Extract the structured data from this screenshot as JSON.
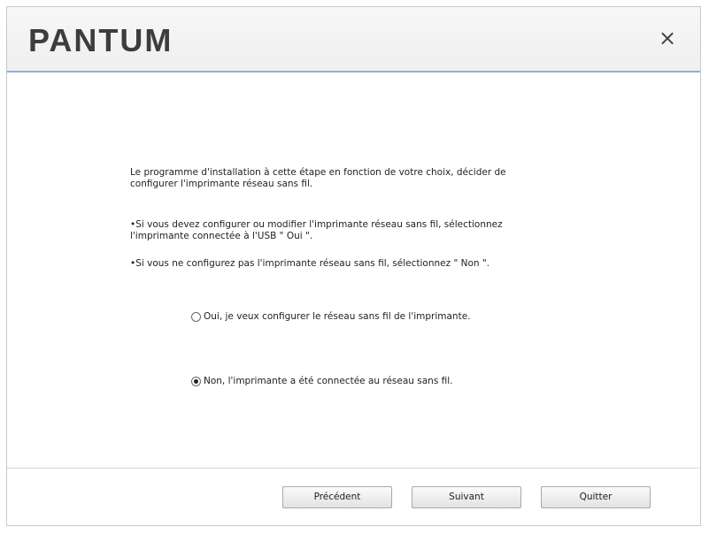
{
  "header": {
    "logo_text": "PANTUM",
    "close_glyph": "×"
  },
  "content": {
    "intro_line1": "Le programme d'installation à cette étape en fonction de votre choix, décider de",
    "intro_line2": "configurer l'imprimante réseau sans fil.",
    "bullet1_line1": "•Si vous devez configurer ou modifier l'imprimante réseau sans fil, sélectionnez",
    "bullet1_line2": "l'imprimante connectée à l'USB \" Oui \".",
    "bullet2": "•Si vous ne configurez pas l'imprimante réseau sans fil, sélectionnez \" Non \".",
    "options": [
      {
        "label": "Oui, je veux configurer le réseau sans fil de l'imprimante.",
        "selected": false
      },
      {
        "label": "Non, l'imprimante a été connectée au réseau sans fil.",
        "selected": true
      }
    ]
  },
  "footer": {
    "prev_label": "Précédent",
    "next_label": "Suivant",
    "quit_label": "Quitter"
  },
  "colors": {
    "header_border": "#8fb1d6",
    "logo": "#3d3d3d"
  }
}
